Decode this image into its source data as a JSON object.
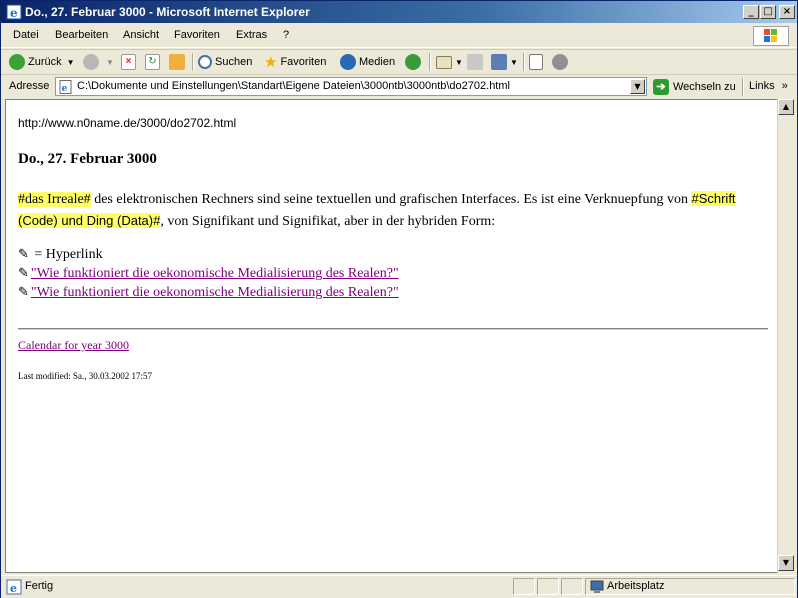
{
  "window": {
    "title": "Do., 27. Februar 3000 - Microsoft Internet Explorer",
    "minimize_label": "_",
    "maximize_label": "□",
    "close_label": "×"
  },
  "menu": {
    "items": [
      "Datei",
      "Bearbeiten",
      "Ansicht",
      "Favoriten",
      "Extras",
      "?"
    ]
  },
  "toolbar": {
    "back_label": "Zurück",
    "search_label": "Suchen",
    "favorites_label": "Favoriten",
    "media_label": "Medien"
  },
  "address": {
    "label": "Adresse",
    "value": "C:\\Dokumente und Einstellungen\\Standart\\Eigene Dateien\\3000ntb\\3000ntb\\do2702.html",
    "go_label": "Wechseln zu",
    "links_label": "Links",
    "links_chevron": "»"
  },
  "page": {
    "url": "http://www.n0name.de/3000/do2702.html",
    "heading": "Do., 27. Februar 3000",
    "hl1": "#das Irreale#",
    "text1": " des elektronischen Rechners sind seine textuellen und grafischen Interfaces. Es ist eine Verknuepfung von ",
    "hl2": "#Schrift (Code) und Ding (Data)#",
    "text2": ", von Signifikant und Signifikat, aber in der hybriden Form:",
    "legend": " = Hyperlink",
    "link1": "\"Wie funktioniert die oekonomische Medialisierung des Realen?\"",
    "link2": "\"Wie funktioniert die oekonomische Medialisierung des Realen?\"",
    "calendar_link": "Calendar for year 3000",
    "last_modified": "Last modified: Sa., 30.03.2002 17:57"
  },
  "status": {
    "text": "Fertig",
    "zone": "Arbeitsplatz"
  },
  "colors": {
    "highlight": "#ffff66",
    "visited_link": "#800080",
    "title_start": "#0a246a",
    "title_end": "#a6caf0"
  }
}
